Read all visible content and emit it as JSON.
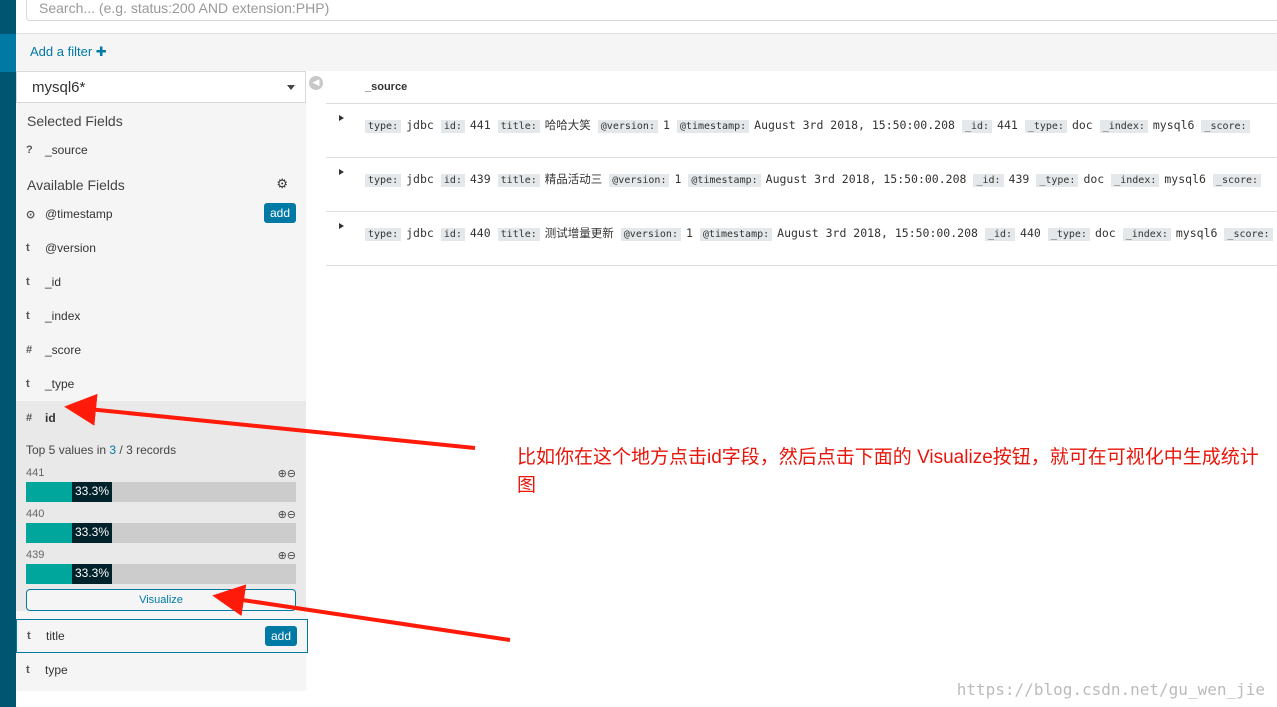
{
  "search": {
    "placeholder": "Search... (e.g. status:200 AND extension:PHP)"
  },
  "filter": {
    "add_label": "Add a filter ✚"
  },
  "sidebar": {
    "index_pattern": "mysql6*",
    "selected_title": "Selected Fields",
    "selected": [
      {
        "type": "?",
        "name": "_source"
      }
    ],
    "available_title": "Available Fields",
    "fields": [
      {
        "type": "⊙",
        "name": "@timestamp",
        "add": "add"
      },
      {
        "type": "t",
        "name": "@version"
      },
      {
        "type": "t",
        "name": "_id"
      },
      {
        "type": "t",
        "name": "_index"
      },
      {
        "type": "#",
        "name": "_score"
      },
      {
        "type": "t",
        "name": "_type"
      }
    ],
    "expanded": {
      "type": "#",
      "name": "id",
      "top_prefix": "Top 5 values in ",
      "top_count": "3",
      "top_suffix": " / 3 records",
      "values": [
        {
          "label": "441",
          "pct": "33.3%",
          "fraction": 0.333
        },
        {
          "label": "440",
          "pct": "33.3%",
          "fraction": 0.333
        },
        {
          "label": "439",
          "pct": "33.3%",
          "fraction": 0.333
        }
      ],
      "visualize": "Visualize"
    },
    "after": [
      {
        "type": "t",
        "name": "title",
        "add": "add"
      },
      {
        "type": "t",
        "name": "type"
      }
    ]
  },
  "main": {
    "header": "_source",
    "rows": [
      [
        [
          "type:",
          "jdbc"
        ],
        [
          "id:",
          "441"
        ],
        [
          "title:",
          "哈哈大笑"
        ],
        [
          "@version:",
          "1"
        ],
        [
          "@timestamp:",
          "August 3rd 2018, 15:50:00.208"
        ],
        [
          "_id:",
          "441"
        ],
        [
          "_type:",
          "doc"
        ],
        [
          "_index:",
          "mysql6"
        ],
        [
          "_score:",
          ""
        ]
      ],
      [
        [
          "type:",
          "jdbc"
        ],
        [
          "id:",
          "439"
        ],
        [
          "title:",
          "精品活动三"
        ],
        [
          "@version:",
          "1"
        ],
        [
          "@timestamp:",
          "August 3rd 2018, 15:50:00.208"
        ],
        [
          "_id:",
          "439"
        ],
        [
          "_type:",
          "doc"
        ],
        [
          "_index:",
          "mysql6"
        ],
        [
          "_score:",
          ""
        ]
      ],
      [
        [
          "type:",
          "jdbc"
        ],
        [
          "id:",
          "440"
        ],
        [
          "title:",
          "测试增量更新"
        ],
        [
          "@version:",
          "1"
        ],
        [
          "@timestamp:",
          "August 3rd 2018, 15:50:00.208"
        ],
        [
          "_id:",
          "440"
        ],
        [
          "_type:",
          "doc"
        ],
        [
          "_index:",
          "mysql6"
        ],
        [
          "_score:",
          ""
        ]
      ]
    ]
  },
  "annotation": {
    "text": "比如你在这个地方点击id字段，然后点击下面的 Visualize按钮，就可在可视化中生成统计图",
    "color": "#e8150a"
  },
  "watermark": "https://blog.csdn.net/gu_wen_jie"
}
